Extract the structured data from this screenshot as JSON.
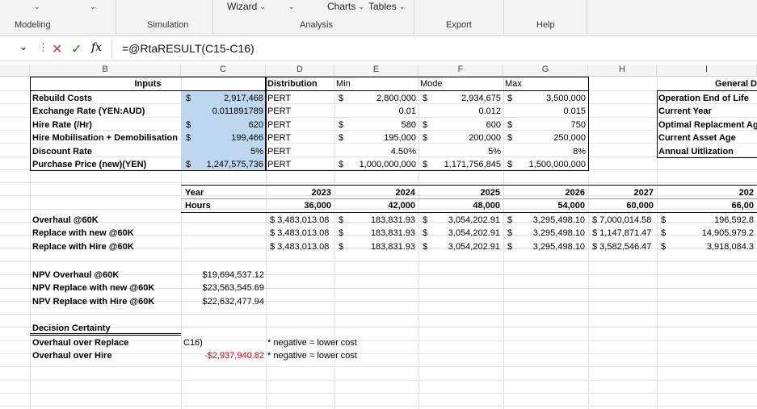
{
  "ribbon": {
    "controls": [
      "Wizard",
      "Charts",
      "Tables"
    ],
    "groups": [
      "Modeling",
      "Simulation",
      "Analysis",
      "Export",
      "Help"
    ]
  },
  "formula_bar": {
    "name_chevron": "⌄",
    "more": "⋮",
    "cancel": "✕",
    "enter": "✓",
    "fx": "fx",
    "formula": "=@RtaRESULT(C15-C16)"
  },
  "columns": [
    "B",
    "C",
    "D",
    "E",
    "F",
    "G",
    "H",
    "I"
  ],
  "inputs_table": {
    "headers": [
      "Inputs",
      "Distribution",
      "Min",
      "Mode",
      "Max"
    ],
    "rows": [
      {
        "label": "Rebuild Costs",
        "cur": "$",
        "value": "2,917,468",
        "dist": "PERT",
        "min_cur": "$",
        "min": "2,800,000",
        "mode_cur": "$",
        "mode": "2,934,675",
        "max_cur": "$",
        "max": "3,500,000"
      },
      {
        "label": "Exchange Rate (YEN:AUD)",
        "cur": "",
        "value": "0.011891789",
        "dist": "PERT",
        "min_cur": "",
        "min": "0.01",
        "mode_cur": "",
        "mode": "0.012",
        "max_cur": "",
        "max": "0.015"
      },
      {
        "label": "Hire Rate (/Hr)",
        "cur": "$",
        "value": "620",
        "dist": "PERT",
        "min_cur": "$",
        "min": "580",
        "mode_cur": "$",
        "mode": "600",
        "max_cur": "$",
        "max": "750"
      },
      {
        "label": "Hire Mobilisation + Demobilisation",
        "cur": "$",
        "value": "199,466",
        "dist": "PERT",
        "min_cur": "$",
        "min": "195,000",
        "mode_cur": "$",
        "mode": "200,000",
        "max_cur": "$",
        "max": "250,000"
      },
      {
        "label": "Discount Rate",
        "cur": "",
        "value": "5%",
        "dist": "PERT",
        "min_cur": "",
        "min": "4.50%",
        "mode_cur": "",
        "mode": "5%",
        "max_cur": "",
        "max": "8%"
      },
      {
        "label": "Purchase Price (new)(YEN)",
        "cur": "$",
        "value": "1,247,575,736",
        "dist": "PERT",
        "min_cur": "$",
        "min": "1,000,000,000",
        "mode_cur": "$",
        "mode": "1,171,756,845",
        "max_cur": "$",
        "max": "1,500,000,000"
      }
    ]
  },
  "general": {
    "header": "General D",
    "items": [
      "Operation End of Life",
      "Current Year",
      "Optimal Replacment Age",
      "Current Asset Age",
      "Annual Uitlization"
    ]
  },
  "years_table": {
    "year_label": "Year",
    "hours_label": "Hours",
    "years": [
      "2023",
      "2024",
      "2025",
      "2026",
      "2027",
      "202"
    ],
    "hours": [
      "36,000",
      "42,000",
      "48,000",
      "54,000",
      "60,000",
      "66,00"
    ],
    "rows": [
      {
        "label": "Overhaul @60K",
        "vals": [
          "$ 3,483,013.08",
          "183,831.93",
          "3,054,202.91",
          "3,295,498.10",
          "$ 7,000,014.58",
          "196,592.8"
        ]
      },
      {
        "label": "Replace with new @60K",
        "vals": [
          "$ 3,483,013.08",
          "183,831.93",
          "3,054,202.91",
          "3,295,498.10",
          "$ 1,147,871.47",
          "14,905,979.2"
        ]
      },
      {
        "label": "Replace with Hire @60K",
        "vals": [
          "$ 3,483,013.08",
          "183,831.93",
          "3,054,202.91",
          "3,295,498.10",
          "$ 3,582,546.47",
          "3,918,084.3"
        ]
      }
    ],
    "dollar": "$"
  },
  "npv": [
    {
      "label": "NPV Overhaul @60K",
      "value": "$19,694,537.12"
    },
    {
      "label": "NPV Replace with new @60K",
      "value": "$23,563,545.69"
    },
    {
      "label": "NPV Replace with Hire @60K",
      "value": "$22,632,477.94"
    }
  ],
  "decision": {
    "title": "Decision Certainty",
    "rows": [
      {
        "label": "Overhaul over Replace",
        "value": "C16)",
        "note": "* negative = lower cost"
      },
      {
        "label": "Overhaul over Hire",
        "value": "-$2,937,940.82",
        "note": "* negative = lower cost"
      }
    ]
  },
  "colors": {
    "input_fill": "#bdd7ee",
    "negative": "#e00000",
    "cancel": "#d13438",
    "enter": "#107c10"
  }
}
